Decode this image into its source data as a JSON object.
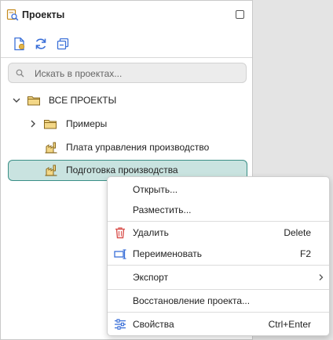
{
  "panel": {
    "title": "Проекты",
    "toolbar": [
      {
        "icon": "new-project-icon"
      },
      {
        "icon": "refresh-icon"
      },
      {
        "icon": "collapse-all-icon"
      }
    ],
    "search": {
      "placeholder": "Искать в проектах...",
      "icon": "search-icon"
    }
  },
  "tree": {
    "root": {
      "label": "ВСЕ ПРОЕКТЫ",
      "expanded": true
    },
    "items": [
      {
        "label": "Примеры",
        "type": "folder",
        "expanded": false
      },
      {
        "label": "Плата управления производство",
        "type": "project"
      },
      {
        "label": "Подготовка производства",
        "type": "project",
        "selected": true
      }
    ]
  },
  "context_menu": {
    "open": "Открыть...",
    "place": "Разместить...",
    "delete": {
      "label": "Удалить",
      "shortcut": "Delete",
      "icon": "trash-icon"
    },
    "rename": {
      "label": "Переименовать",
      "shortcut": "F2",
      "icon": "rename-icon"
    },
    "export": {
      "label": "Экспорт",
      "icon": "chevron-right-icon"
    },
    "restore": "Восстановление проекта...",
    "properties": {
      "label": "Свойства",
      "shortcut": "Ctrl+Enter",
      "icon": "sliders-icon"
    }
  },
  "colors": {
    "accent": "#3a8f86",
    "selection_bg": "#c9e3e0",
    "folder": "#e0b54a",
    "danger": "#d9534f",
    "icon_blue": "#3a6fd8"
  }
}
